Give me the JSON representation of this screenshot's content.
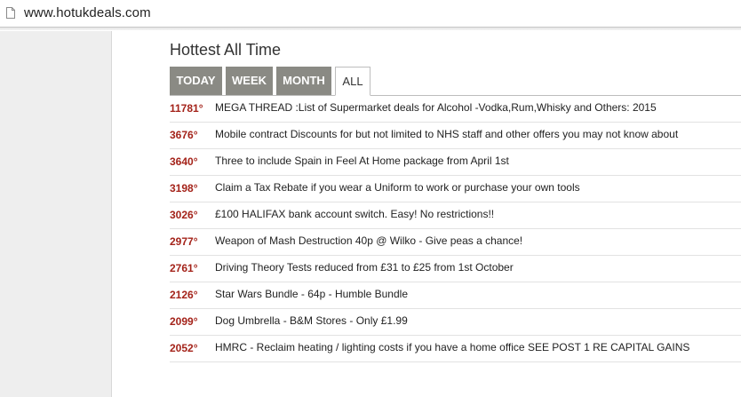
{
  "browser": {
    "url": "www.hotukdeals.com",
    "page_icon": "page-icon"
  },
  "section": {
    "title": "Hottest All Time"
  },
  "tabs": [
    {
      "label": "TODAY",
      "active": false
    },
    {
      "label": "WEEK",
      "active": false
    },
    {
      "label": "MONTH",
      "active": false
    },
    {
      "label": "ALL",
      "active": true
    }
  ],
  "deals": [
    {
      "temp": "11781°",
      "title": "MEGA THREAD :List of Supermarket deals for Alcohol -Vodka,Rum,Whisky and Others: 2015"
    },
    {
      "temp": "3676°",
      "title": "Mobile contract Discounts for but not limited to NHS staff and other offers you may not know about"
    },
    {
      "temp": "3640°",
      "title": "Three to include Spain in Feel At Home package from April 1st"
    },
    {
      "temp": "3198°",
      "title": "Claim a Tax Rebate if you wear a Uniform to work or purchase your own tools"
    },
    {
      "temp": "3026°",
      "title": "£100 HALIFAX bank account switch. Easy! No restrictions!!"
    },
    {
      "temp": "2977°",
      "title": "Weapon of Mash Destruction 40p @ Wilko - Give peas a chance!"
    },
    {
      "temp": "2761°",
      "title": "Driving Theory Tests reduced from £31 to £25 from 1st October"
    },
    {
      "temp": "2126°",
      "title": "Star Wars Bundle - 64p - Humble Bundle"
    },
    {
      "temp": "2099°",
      "title": "Dog Umbrella - B&M Stores - Only £1.99"
    },
    {
      "temp": "2052°",
      "title": "HMRC - Reclaim heating / lighting costs if you have a home office SEE POST 1 RE CAPITAL GAINS"
    }
  ],
  "colors": {
    "temperature": "#a4231a",
    "tab_inactive_bg": "#8a8a84",
    "left_panel_bg": "#eeeeee"
  }
}
